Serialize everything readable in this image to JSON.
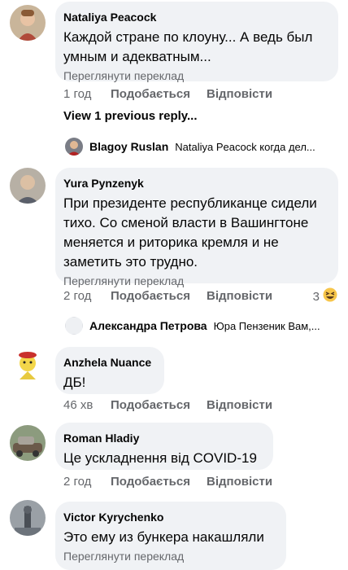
{
  "comments": [
    {
      "author": "Nataliya Peacock",
      "text": "Каждой стране по клоуну... А ведь был умным и адекватным...",
      "translate": "Переглянути переклад",
      "time": "1 год",
      "like": "Подобається",
      "reply": "Відповісти"
    },
    {
      "author": "Yura Pynzenyk",
      "text": "При президенте республиканце сидели тихо. Со сменой власти в Вашингтоне меняется и риторика кремля и не заметить это трудно.",
      "translate": "Переглянути переклад",
      "time": "2 год",
      "like": "Подобається",
      "reply": "Відповісти",
      "reactions": "3"
    },
    {
      "author": "Anzhela Nuance",
      "text": "ДБ!",
      "time": "46 хв",
      "like": "Подобається",
      "reply": "Відповісти"
    },
    {
      "author": "Roman Hladiy",
      "text": "Це ускладнення від COVID-19",
      "time": "2 год",
      "like": "Подобається",
      "reply": "Відповісти"
    },
    {
      "author": "Victor Kyrychenko",
      "text": "Это ему из бункера накашляли",
      "translate": "Переглянути переклад"
    }
  ],
  "view_previous": "View 1 previous reply...",
  "replies": [
    {
      "name": "Blagoy Ruslan",
      "text": "Nataliya Peacock когда дел..."
    },
    {
      "name": "Александра Петрова",
      "text": "Юра Пензеник Вам,..."
    }
  ],
  "colors": {
    "bubble": "#f0f2f5",
    "meta": "#65676b",
    "text": "#050505"
  },
  "icons": [
    "haha-reaction-icon"
  ]
}
